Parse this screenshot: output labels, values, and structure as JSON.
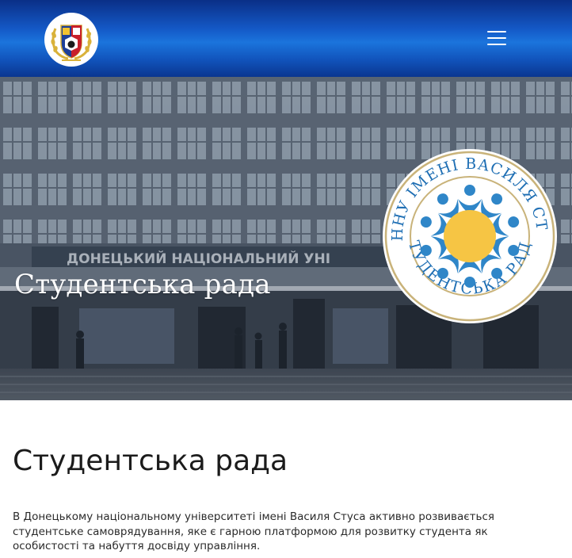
{
  "header": {
    "logo": "university-crest-logo",
    "menu_icon": "hamburger-menu-icon"
  },
  "hero": {
    "title": "Студентська рада",
    "building_sign": "ДОНЕЦЬКИЙ НАЦІОНАЛЬНИЙ УНІ",
    "council_logo": {
      "top_text": "ДОННУ ІМЕНІ ВАСИЛЯ СТУСА",
      "bottom_text": "СТУДЕНТСЬКА РАДА",
      "colors": {
        "sun": "#f6c544",
        "figures": "#2f86c8",
        "ring": "#c9b37a"
      }
    }
  },
  "content": {
    "heading": "Студентська рада",
    "intro": "В Донецькому національному університеті імені Василя Стуса активно розвивається студентське самоврядування, яке є гарною платформою для розвитку студента як особистості та набуття досвіду управління."
  },
  "colors": {
    "header_blue": "#1459c7",
    "header_dark": "#0a2f87"
  }
}
